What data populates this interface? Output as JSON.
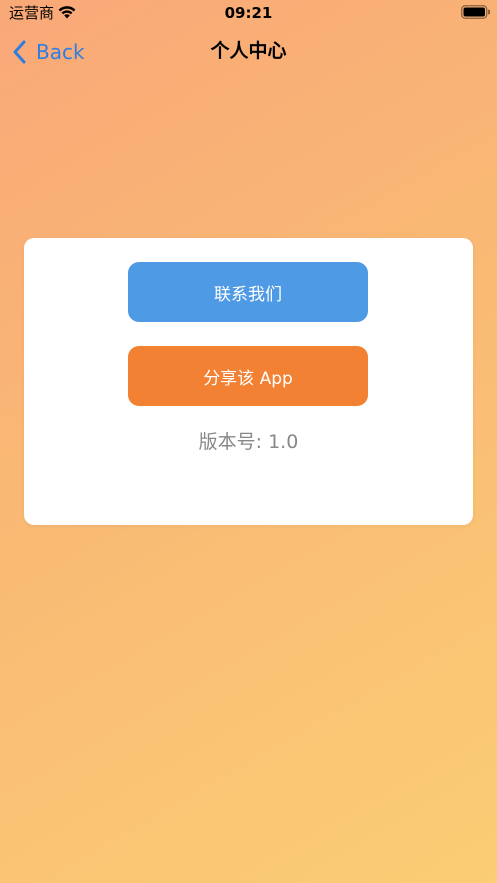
{
  "status_bar": {
    "carrier": "运营商",
    "time": "09:21"
  },
  "nav": {
    "back_label": "Back",
    "title": "个人中心"
  },
  "card": {
    "contact_label": "联系我们",
    "share_label": "分享该 App",
    "version_text": "版本号: 1.0"
  },
  "colors": {
    "accent_blue": "#4f9ae4",
    "accent_orange": "#f28134",
    "back_blue": "#2f7de1"
  }
}
